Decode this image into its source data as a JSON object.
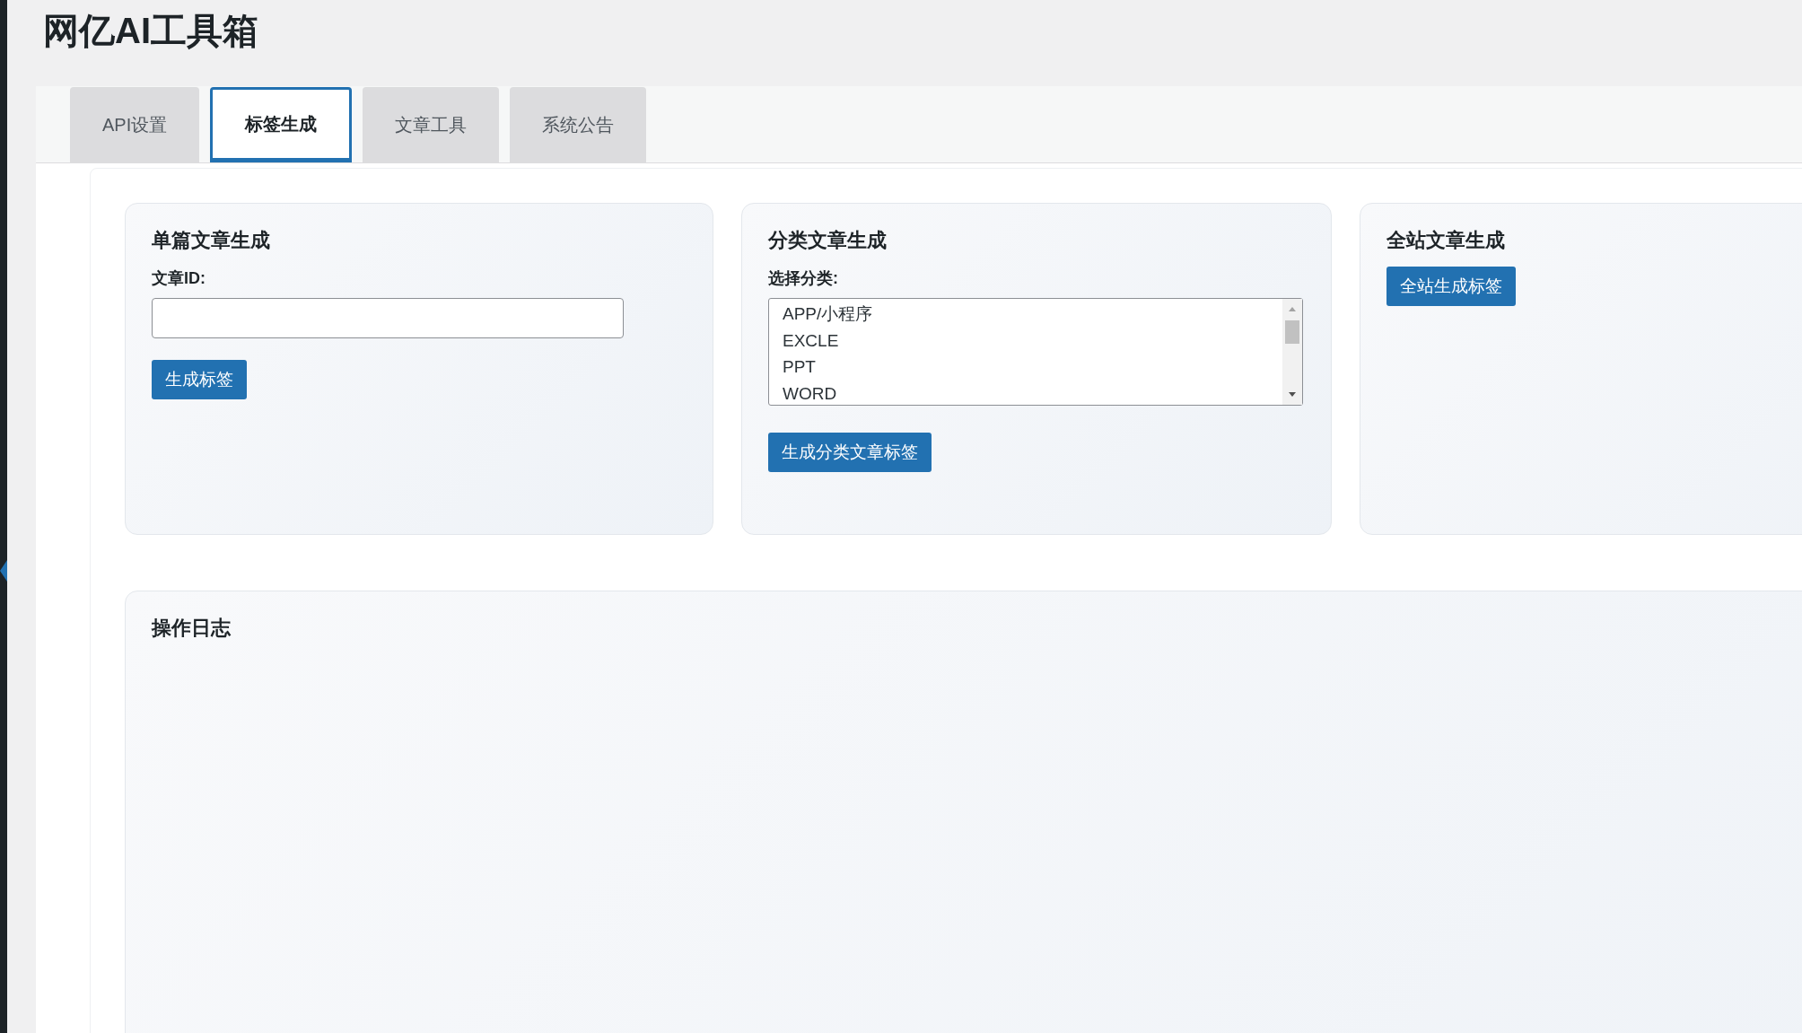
{
  "page_title": "网亿AI工具箱",
  "tabs": [
    {
      "label": "API设置",
      "selected": false
    },
    {
      "label": "标签生成",
      "selected": true
    },
    {
      "label": "文章工具",
      "selected": false
    },
    {
      "label": "系统公告",
      "selected": false
    }
  ],
  "panels": [
    {
      "kind": "single",
      "title": "单篇文章生成",
      "field_label": "文章ID:",
      "button": "生成标签"
    },
    {
      "kind": "category",
      "title": "分类文章生成",
      "field_label": "选择分类:",
      "options": [
        "APP/小程序",
        "EXCLE",
        "PPT",
        "WORD"
      ],
      "button": "生成分类文章标签"
    },
    {
      "kind": "site",
      "title": "全站文章生成",
      "button": "全站生成标签"
    }
  ],
  "log": {
    "title": "操作日志"
  }
}
